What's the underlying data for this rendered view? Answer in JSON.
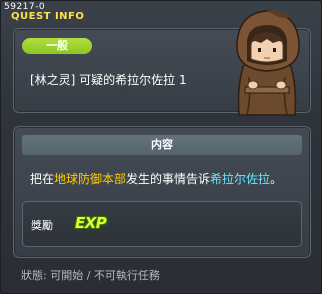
{
  "window": {
    "quest_id": "59217-0",
    "title": "QUEST INFO"
  },
  "quest": {
    "category": "一般",
    "name": "[林之灵] 可疑的希拉尔佐拉 1"
  },
  "content": {
    "header": "内容",
    "objective_prefix": "把在",
    "objective_place": "地球防御本部",
    "objective_middle": "发生的事情告诉",
    "objective_npc": "希拉尔佐拉",
    "objective_suffix": "。"
  },
  "reward": {
    "label": "獎勵",
    "exp_icon_text": "EXP"
  },
  "status": "狀態: 可開始 / 不可執行任務",
  "colors": {
    "category_badge": "#9bd12a",
    "highlight_place": "#ffcc00",
    "highlight_npc": "#66e5ff",
    "title_text": "#ffe14a"
  }
}
